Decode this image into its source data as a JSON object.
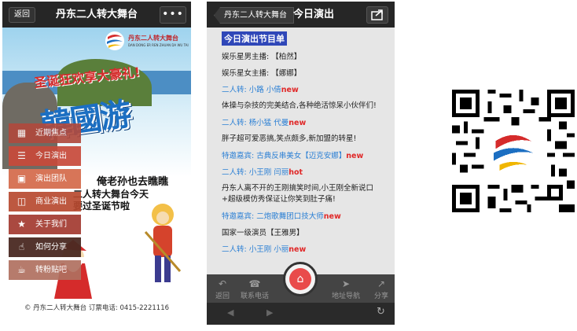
{
  "left_screen": {
    "back_label": "返回",
    "title": "丹东二人转大舞台",
    "more_label": "•••",
    "banner": {
      "logo_text": "丹东二人转大舞台",
      "logo_sub": "DAN DONG ER REN ZHUAN DA WU TAI",
      "xmas_line": "圣诞狂欢享大豪礼!",
      "big_title": "韓國游",
      "slogan1": "俺老孙也去瞧瞧",
      "slogan2a": "二人转大舞台今天",
      "slogan2b": "要过圣诞节啦"
    },
    "menu": [
      {
        "label": "近期焦点",
        "icon": "calendar-icon",
        "color": "#b04a3e"
      },
      {
        "label": "今日演出",
        "icon": "list-icon",
        "color": "#c84a3a"
      },
      {
        "label": "演出团队",
        "icon": "image-icon",
        "color": "#d46a4a"
      },
      {
        "label": "商业演出",
        "icon": "windows-icon",
        "color": "#b84a30"
      },
      {
        "label": "关于我们",
        "icon": "trophy-icon",
        "color": "#a33a30"
      },
      {
        "label": "如何分享",
        "icon": "thumbs-up-icon",
        "color": "#4a2a22"
      },
      {
        "label": "转粉贴吧",
        "icon": "coffee-icon",
        "color": "#b07060"
      }
    ],
    "footer": "© 丹东二人转大舞台 订票电话: 0415-2221116"
  },
  "middle_screen": {
    "back_label": "丹东二人转大舞台",
    "title": "今日演出",
    "program_title": "今日演出节目单",
    "lines": [
      {
        "text": "娱乐星男主播: 【柏然】",
        "style": "normal"
      },
      {
        "text": "娱乐星女主播: 【娜娜】",
        "style": "normal"
      },
      {
        "text": "二人转: 小路 小倩",
        "style": "blue",
        "tag": "new"
      },
      {
        "text": "体操与杂技的完美结合,各种绝活惊呆小伙伴们!",
        "style": "desc"
      },
      {
        "text": "二人转: 杨小猛 代曼",
        "style": "blue",
        "tag": "new"
      },
      {
        "text": "胖子超可爱恶搞,笑点颇多,新加盟的转星!",
        "style": "desc"
      },
      {
        "text": "特邀嘉宾: 古典反串美女【迈克安娜】",
        "style": "blue",
        "tag": "new"
      },
      {
        "text": "二人转: 小王刚 闫丽",
        "style": "blue",
        "tag": "hot"
      },
      {
        "text": "丹东人离不开的王刚搞笑时间,小王刚全新说口+超级模仿秀保证让你笑到肚子痛!",
        "style": "desc"
      },
      {
        "text": "特邀嘉宾: 二炮歌舞团口技大师",
        "style": "blue",
        "tag": "new"
      },
      {
        "text": "国家一级演员【王雅男】",
        "style": "normal"
      },
      {
        "text": "二人转: 小王刚 小丽",
        "style": "blue",
        "tag": "new"
      }
    ],
    "toolbar": {
      "back": "返回",
      "contact": "联系电话",
      "address": "地址导航",
      "share": "分享"
    },
    "colors": {
      "accent": "#e94b4b",
      "link": "#2a7fd4",
      "highlight": "#2f47b8"
    }
  }
}
